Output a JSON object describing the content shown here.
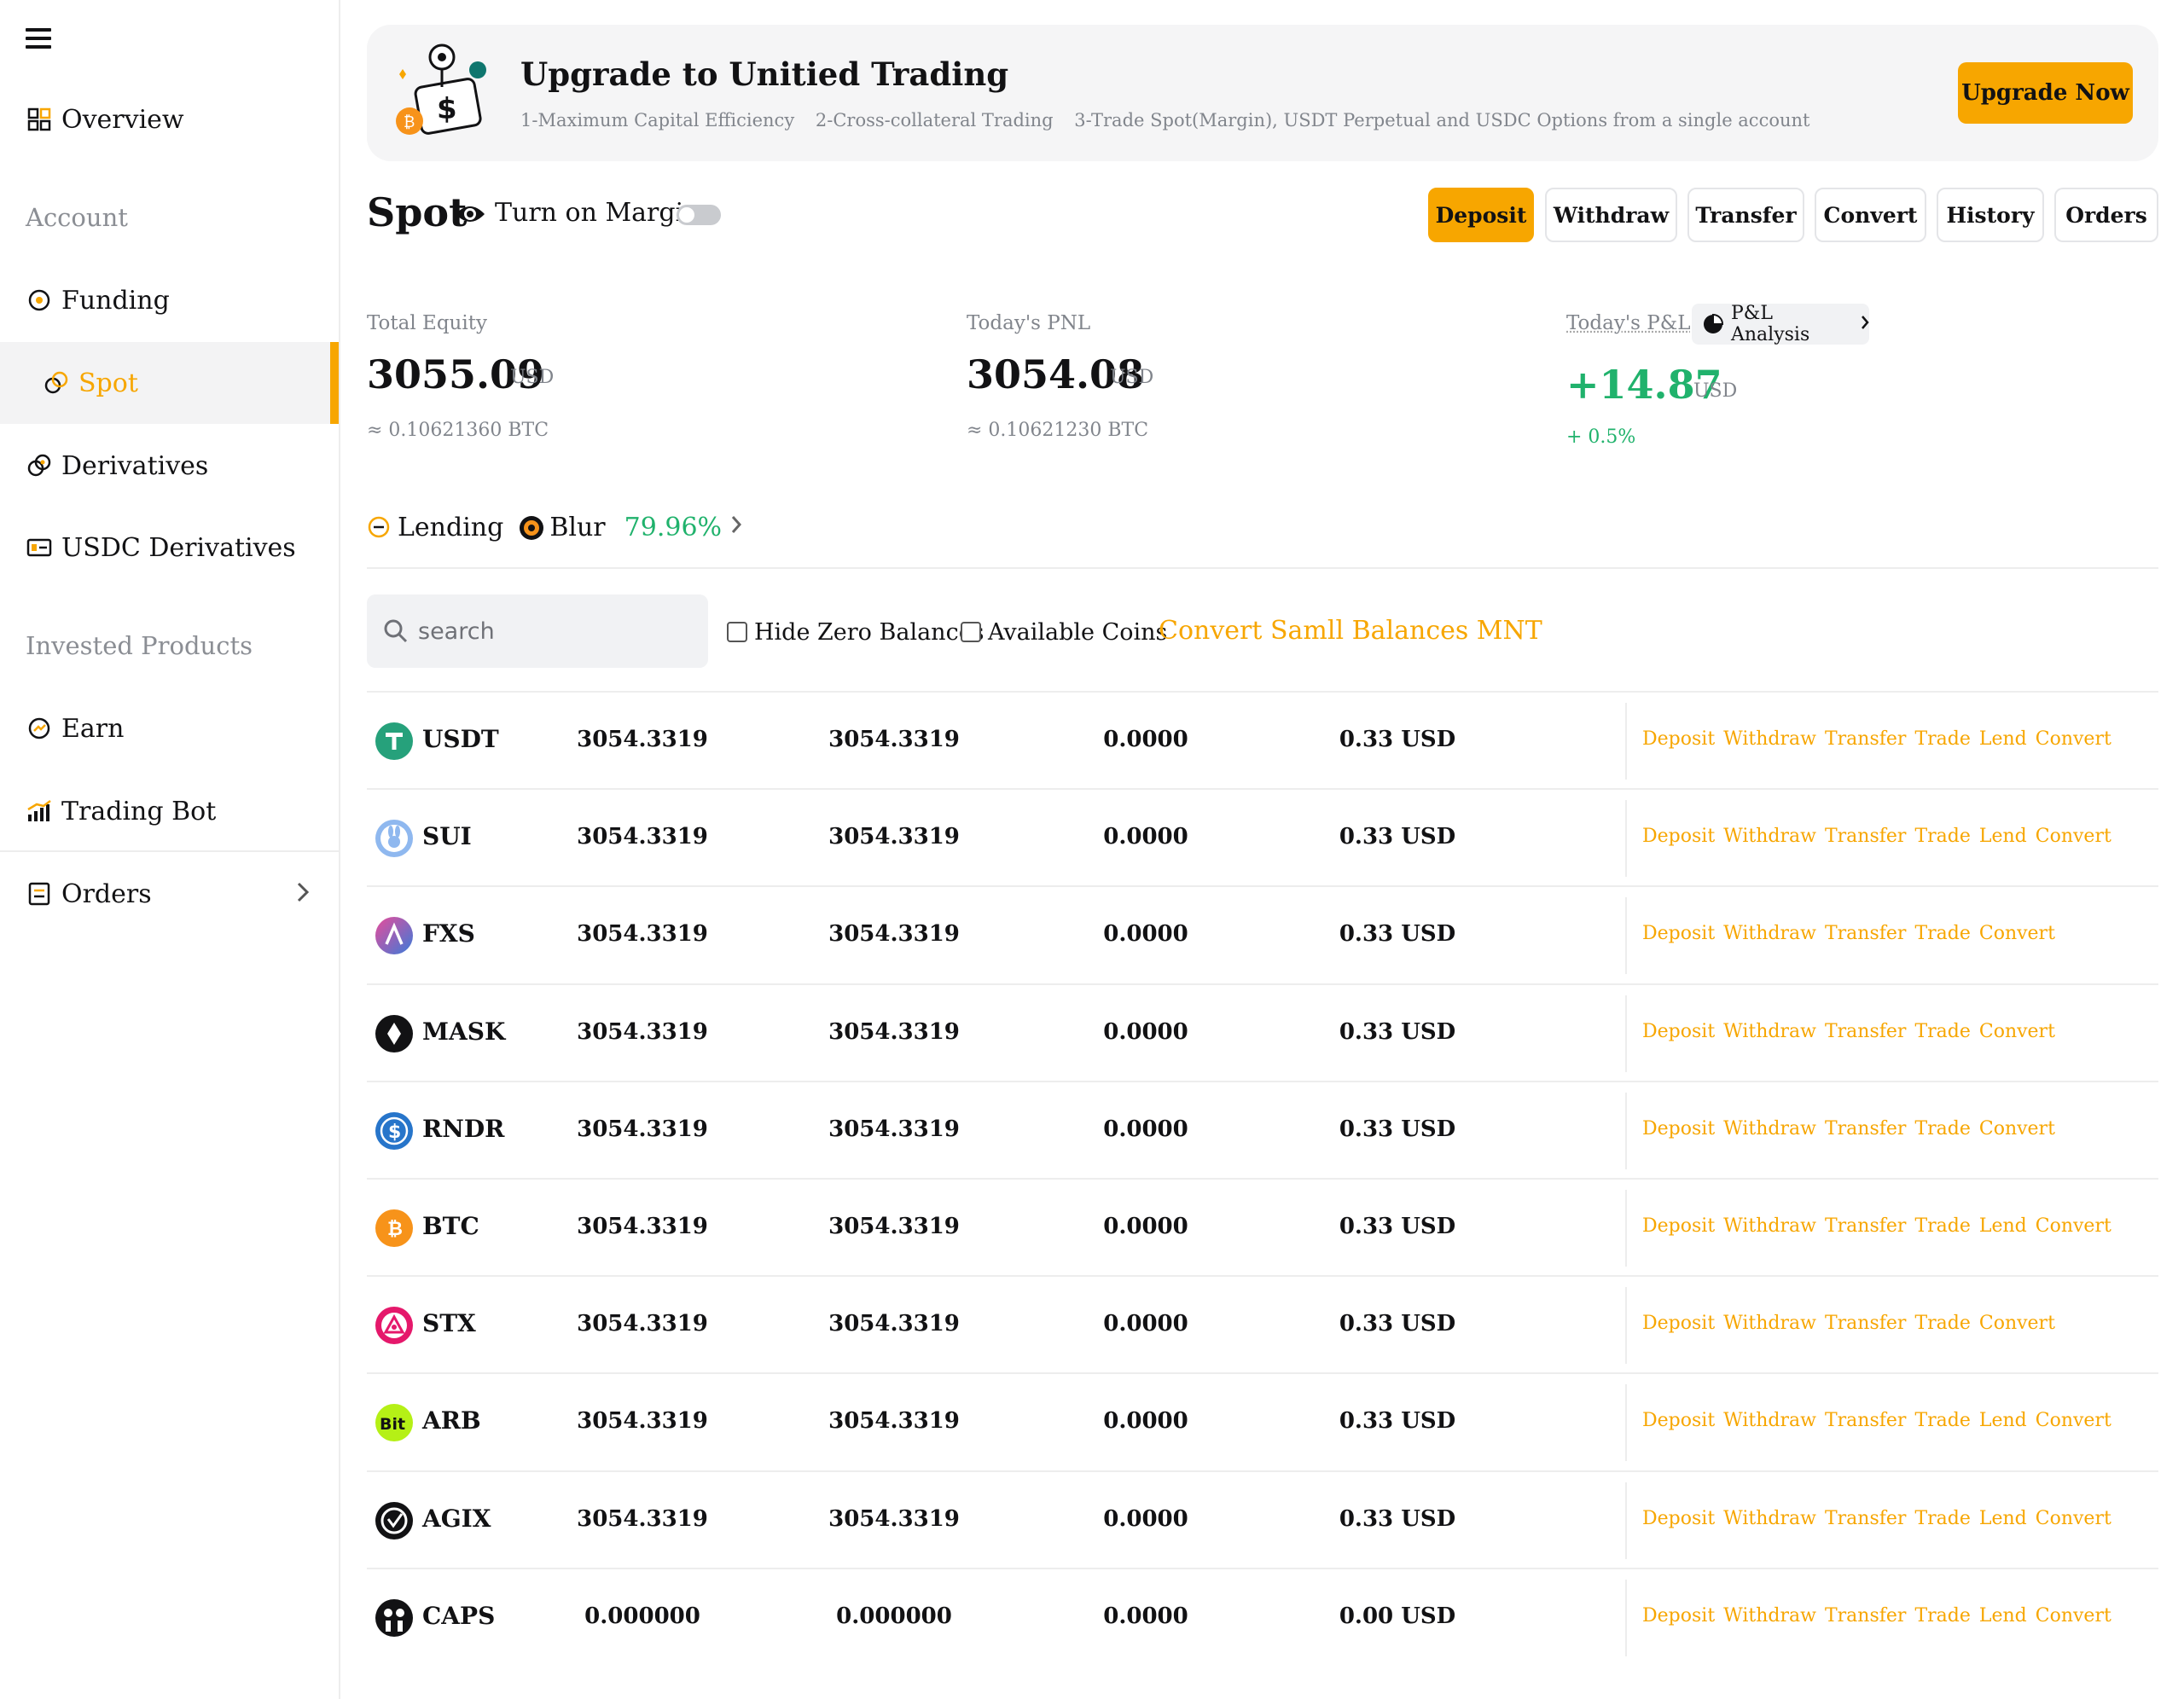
{
  "sidebar": {
    "overview": "Overview",
    "account_section": "Account",
    "funding": "Funding",
    "spot": "Spot",
    "derivatives": "Derivatives",
    "usdc_derivatives": "USDC Derivatives",
    "invested_section": "Invested Products",
    "earn": "Earn",
    "trading_bot": "Trading Bot",
    "orders": "Orders"
  },
  "banner": {
    "title": "Upgrade to Unitied Trading",
    "features": [
      "1-Maximum Capital Efficiency",
      "2-Cross-collateral Trading",
      "3-Trade Spot(Margin), USDT Perpetual and USDC Options from a single account"
    ],
    "button": "Upgrade Now"
  },
  "header": {
    "title": "Spot",
    "margin_label": "Turn on Margin",
    "margin_enabled": false,
    "actions": [
      "Deposit",
      "Withdraw",
      "Transfer",
      "Convert",
      "History",
      "Orders"
    ]
  },
  "stats": {
    "total_equity": {
      "label": "Total Equity",
      "value": "3055.09",
      "unit": "USD",
      "sub": "≈ 0.10621360 BTC"
    },
    "todays_pnl": {
      "label": "Today's PNL",
      "value": "3054.08",
      "unit": "USD",
      "sub": "≈ 0.10621230 BTC"
    },
    "todays_pl": {
      "label": "Today's P&L",
      "analysis_button": "P&L Analysis",
      "value": "+14.87",
      "unit": "USD",
      "sub": "+ 0.5%"
    }
  },
  "lending": {
    "label": "Lending",
    "coin": "Blur",
    "rate": "79.96%"
  },
  "filters": {
    "search_placeholder": "search",
    "hide_zero": "Hide Zero Balances",
    "available_coins": "Available Coins",
    "convert_small": "Convert Samll Balances MNT"
  },
  "colors": {
    "accent": "#f7a600",
    "positive": "#20b26c",
    "muted": "#81858c"
  },
  "assets": [
    {
      "coin": "USDT",
      "col1": "3054.3319",
      "col2": "3054.3319",
      "col3": "0.0000",
      "usd": "0.33 USD",
      "actions": [
        "Deposit",
        "Withdraw",
        "Transfer",
        "Trade",
        "Lend",
        "Convert"
      ],
      "icon": "usdt-icon"
    },
    {
      "coin": "SUI",
      "col1": "3054.3319",
      "col2": "3054.3319",
      "col3": "0.0000",
      "usd": "0.33 USD",
      "actions": [
        "Deposit",
        "Withdraw",
        "Transfer",
        "Trade",
        "Lend",
        "Convert"
      ],
      "icon": "sui-icon"
    },
    {
      "coin": "FXS",
      "col1": "3054.3319",
      "col2": "3054.3319",
      "col3": "0.0000",
      "usd": "0.33 USD",
      "actions": [
        "Deposit",
        "Withdraw",
        "Transfer",
        "Trade",
        "Convert"
      ],
      "icon": "fxs-icon"
    },
    {
      "coin": "MASK",
      "col1": "3054.3319",
      "col2": "3054.3319",
      "col3": "0.0000",
      "usd": "0.33 USD",
      "actions": [
        "Deposit",
        "Withdraw",
        "Transfer",
        "Trade",
        "Convert"
      ],
      "icon": "mask-icon"
    },
    {
      "coin": "RNDR",
      "col1": "3054.3319",
      "col2": "3054.3319",
      "col3": "0.0000",
      "usd": "0.33 USD",
      "actions": [
        "Deposit",
        "Withdraw",
        "Transfer",
        "Trade",
        "Convert"
      ],
      "icon": "rndr-icon"
    },
    {
      "coin": "BTC",
      "col1": "3054.3319",
      "col2": "3054.3319",
      "col3": "0.0000",
      "usd": "0.33 USD",
      "actions": [
        "Deposit",
        "Withdraw",
        "Transfer",
        "Trade",
        "Lend",
        "Convert"
      ],
      "icon": "btc-icon"
    },
    {
      "coin": "STX",
      "col1": "3054.3319",
      "col2": "3054.3319",
      "col3": "0.0000",
      "usd": "0.33 USD",
      "actions": [
        "Deposit",
        "Withdraw",
        "Transfer",
        "Trade",
        "Convert"
      ],
      "icon": "stx-icon"
    },
    {
      "coin": "ARB",
      "col1": "3054.3319",
      "col2": "3054.3319",
      "col3": "0.0000",
      "usd": "0.33 USD",
      "actions": [
        "Deposit",
        "Withdraw",
        "Transfer",
        "Trade",
        "Lend",
        "Convert"
      ],
      "icon": "arb-icon"
    },
    {
      "coin": "AGIX",
      "col1": "3054.3319",
      "col2": "3054.3319",
      "col3": "0.0000",
      "usd": "0.33 USD",
      "actions": [
        "Deposit",
        "Withdraw",
        "Transfer",
        "Trade",
        "Lend",
        "Convert"
      ],
      "icon": "agix-icon"
    },
    {
      "coin": "CAPS",
      "col1": "0.000000",
      "col2": "0.000000",
      "col3": "0.0000",
      "usd": "0.00 USD",
      "actions": [
        "Deposit",
        "Withdraw",
        "Transfer",
        "Trade",
        "Lend",
        "Convert"
      ],
      "icon": "caps-icon"
    }
  ]
}
